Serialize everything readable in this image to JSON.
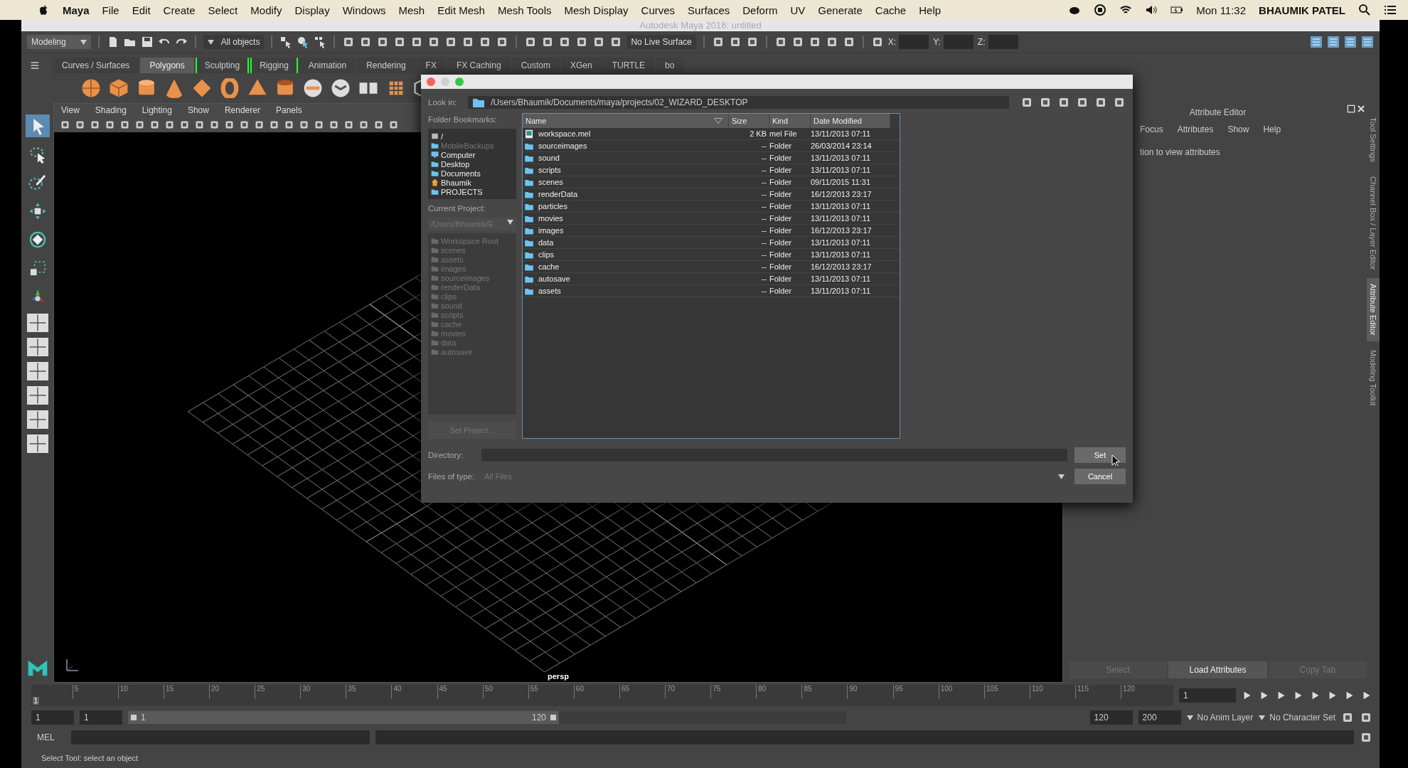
{
  "menubar": {
    "app": "Maya",
    "menus": [
      "File",
      "Edit",
      "Create",
      "Select",
      "Modify",
      "Display",
      "Windows",
      "Mesh",
      "Edit Mesh",
      "Mesh Tools",
      "Mesh Display",
      "Curves",
      "Surfaces",
      "Deform",
      "UV",
      "Generate",
      "Cache",
      "Help"
    ],
    "clock": "Mon 11:32",
    "user": "BHAUMIK PATEL"
  },
  "window": {
    "title": "Autodesk Maya 2016: untitled"
  },
  "status_line": {
    "menu_set": "Modeling",
    "selection_mask": "All objects",
    "live_surface": "No Live Surface",
    "coord_labels": [
      "X:",
      "Y:",
      "Z:"
    ]
  },
  "shelf_tabs": [
    {
      "label": "Curves / Surfaces",
      "selected": false,
      "bracketed": false
    },
    {
      "label": "Polygons",
      "selected": true,
      "bracketed": false
    },
    {
      "label": "Sculpting",
      "selected": false,
      "bracketed": true
    },
    {
      "label": "Rigging",
      "selected": false,
      "bracketed": true
    },
    {
      "label": "Animation",
      "selected": false,
      "bracketed": false
    },
    {
      "label": "Rendering",
      "selected": false,
      "bracketed": false
    },
    {
      "label": "FX",
      "selected": false,
      "bracketed": false
    },
    {
      "label": "FX Caching",
      "selected": false,
      "bracketed": false
    },
    {
      "label": "Custom",
      "selected": false,
      "bracketed": false
    },
    {
      "label": "XGen",
      "selected": false,
      "bracketed": false
    },
    {
      "label": "TURTLE",
      "selected": false,
      "bracketed": false
    },
    {
      "label": "bo",
      "selected": false,
      "bracketed": false
    }
  ],
  "toolbox": [
    {
      "selected": true
    },
    {
      "selected": false
    },
    {
      "selected": false
    },
    {
      "selected": false
    },
    {
      "selected": false
    },
    {
      "selected": false
    },
    {
      "selected": false
    }
  ],
  "panel_menu": [
    "View",
    "Shading",
    "Lighting",
    "Show",
    "Renderer",
    "Panels"
  ],
  "viewport": {
    "camera": "persp"
  },
  "attribute_editor": {
    "title": "Attribute Editor",
    "menus": [
      "Focus",
      "Attributes",
      "Show",
      "Help"
    ],
    "message": "tion to view attributes",
    "buttons": [
      {
        "label": "Select",
        "disabled": true
      },
      {
        "label": "Load Attributes",
        "disabled": false
      },
      {
        "label": "Copy Tab",
        "disabled": true
      }
    ]
  },
  "side_tabs": [
    {
      "label": "Tool Settings",
      "selected": false
    },
    {
      "label": "Channel Box / Layer Editor",
      "selected": false
    },
    {
      "label": "Attribute Editor",
      "selected": true
    },
    {
      "label": "Modeling Toolkit",
      "selected": false
    }
  ],
  "time_slider": {
    "ticks": [
      "5",
      "10",
      "15",
      "20",
      "25",
      "30",
      "35",
      "40",
      "45",
      "50",
      "55",
      "60",
      "65",
      "70",
      "75",
      "80",
      "85",
      "90",
      "95",
      "100",
      "105",
      "110",
      "115",
      "120"
    ],
    "current": "1",
    "current_field": "1",
    "level": 0
  },
  "range": {
    "start": "1",
    "playback_start": "1",
    "bar_start": "1",
    "bar_end": "120",
    "level": 0.6,
    "playback_end": "120",
    "end": "200",
    "anim_layer": "No Anim Layer",
    "character_set": "No Character Set"
  },
  "command_line": {
    "language": "MEL"
  },
  "help_line": "Select Tool: select an object",
  "dialog": {
    "look_in_label": "Look in:",
    "path": "/Users/Bhaumik/Documents/maya/projects/02_WIZARD_DESKTOP",
    "bookmarks_label": "Folder Bookmarks:",
    "bookmarks": [
      {
        "name": "/",
        "kind": "drive",
        "disabled": false
      },
      {
        "name": "MobileBackups",
        "kind": "folder",
        "disabled": true
      },
      {
        "name": "Computer",
        "kind": "computer",
        "disabled": false
      },
      {
        "name": "Desktop",
        "kind": "folder",
        "disabled": false
      },
      {
        "name": "Documents",
        "kind": "folder",
        "disabled": false
      },
      {
        "name": "Bhaumik",
        "kind": "home",
        "disabled": false
      },
      {
        "name": "PROJECTS",
        "kind": "folder",
        "disabled": false
      }
    ],
    "current_project_label": "Current Project:",
    "current_project": "/Users/Bhaumik/E",
    "project_tree": [
      "Workspace Root",
      "scenes",
      "assets",
      "images",
      "sourceimages",
      "renderData",
      "clips",
      "sound",
      "scripts",
      "cache",
      "movies",
      "data",
      "autosave"
    ],
    "set_project": "Set Project...",
    "columns": [
      "Name",
      "Size",
      "Kind",
      "Date Modified"
    ],
    "rows": [
      {
        "name": "workspace.mel",
        "kind": "file",
        "size": "2 KB",
        "type": "mel File",
        "date": "13/11/2013 07:11"
      },
      {
        "name": "sourceimages",
        "kind": "folder",
        "size": "--",
        "type": "Folder",
        "date": "26/03/2014 23:14"
      },
      {
        "name": "sound",
        "kind": "folder",
        "size": "--",
        "type": "Folder",
        "date": "13/11/2013 07:11"
      },
      {
        "name": "scripts",
        "kind": "folder",
        "size": "--",
        "type": "Folder",
        "date": "13/11/2013 07:11"
      },
      {
        "name": "scenes",
        "kind": "folder",
        "size": "--",
        "type": "Folder",
        "date": "09/11/2015 11:31"
      },
      {
        "name": "renderData",
        "kind": "folder",
        "size": "--",
        "type": "Folder",
        "date": "16/12/2013 23:17"
      },
      {
        "name": "particles",
        "kind": "folder",
        "size": "--",
        "type": "Folder",
        "date": "13/11/2013 07:11"
      },
      {
        "name": "movies",
        "kind": "folder",
        "size": "--",
        "type": "Folder",
        "date": "13/11/2013 07:11"
      },
      {
        "name": "images",
        "kind": "folder",
        "size": "--",
        "type": "Folder",
        "date": "16/12/2013 23:17"
      },
      {
        "name": "data",
        "kind": "folder",
        "size": "--",
        "type": "Folder",
        "date": "13/11/2013 07:11"
      },
      {
        "name": "clips",
        "kind": "folder",
        "size": "--",
        "type": "Folder",
        "date": "13/11/2013 07:11"
      },
      {
        "name": "cache",
        "kind": "folder",
        "size": "--",
        "type": "Folder",
        "date": "16/12/2013 23:17"
      },
      {
        "name": "autosave",
        "kind": "folder",
        "size": "--",
        "type": "Folder",
        "date": "13/11/2013 07:11"
      },
      {
        "name": "assets",
        "kind": "folder",
        "size": "--",
        "type": "Folder",
        "date": "13/11/2013 07:11"
      }
    ],
    "directory_label": "Directory:",
    "files_of_type_label": "Files of type:",
    "files_of_type": "All Files",
    "buttons": [
      "Set",
      "Cancel"
    ]
  }
}
